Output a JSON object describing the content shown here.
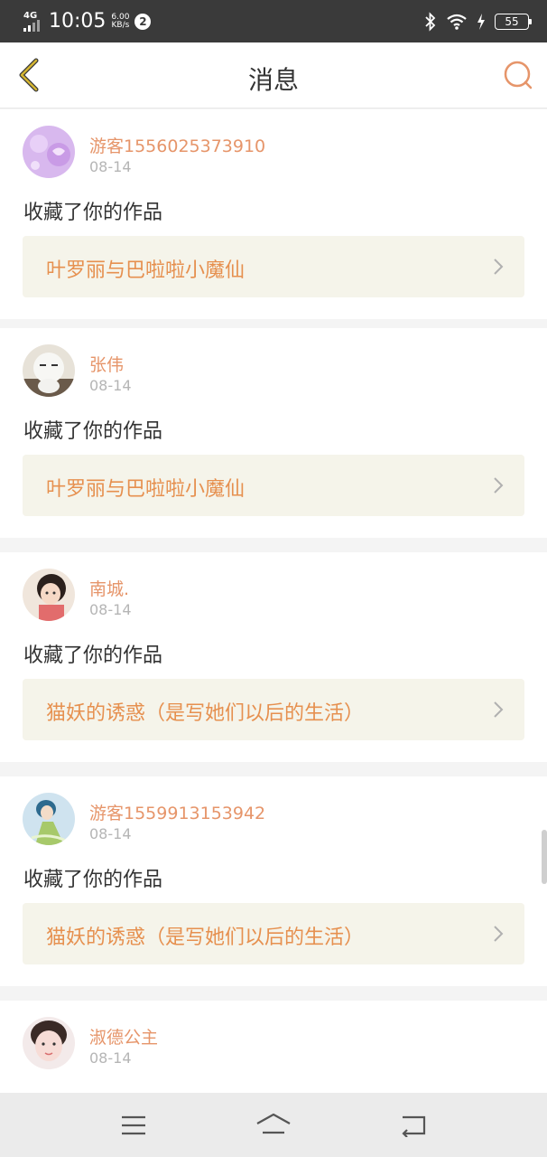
{
  "status_bar": {
    "network": "4G",
    "time": "10:05",
    "speed_value": "6.00",
    "speed_unit": "KB/s",
    "notification_count": "2",
    "battery": "55"
  },
  "header": {
    "title": "消息"
  },
  "messages": [
    {
      "user": "游客1556025373910",
      "date": "08-14",
      "action": "收藏了你的作品",
      "work": "叶罗丽与巴啦啦小魔仙"
    },
    {
      "user": "张伟",
      "date": "08-14",
      "action": "收藏了你的作品",
      "work": "叶罗丽与巴啦啦小魔仙"
    },
    {
      "user": "南城.",
      "date": "08-14",
      "action": "收藏了你的作品",
      "work": "猫妖的诱惑（是写她们以后的生活）"
    },
    {
      "user": "游客1559913153942",
      "date": "08-14",
      "action": "收藏了你的作品",
      "work": "猫妖的诱惑（是写她们以后的生活）"
    },
    {
      "user": "淑德公主",
      "date": "08-14",
      "action": "",
      "work": ""
    }
  ],
  "icons": {
    "back": "chevron-left-icon",
    "search": "search-icon",
    "work_arrow": "chevron-right-icon",
    "nav_menu": "menu-icon",
    "nav_home": "home-icon",
    "nav_back": "back-icon"
  },
  "colors": {
    "accent_orange": "#e6956a",
    "back_arrow": "#d4b531",
    "work_bg": "#f5f4ea"
  }
}
